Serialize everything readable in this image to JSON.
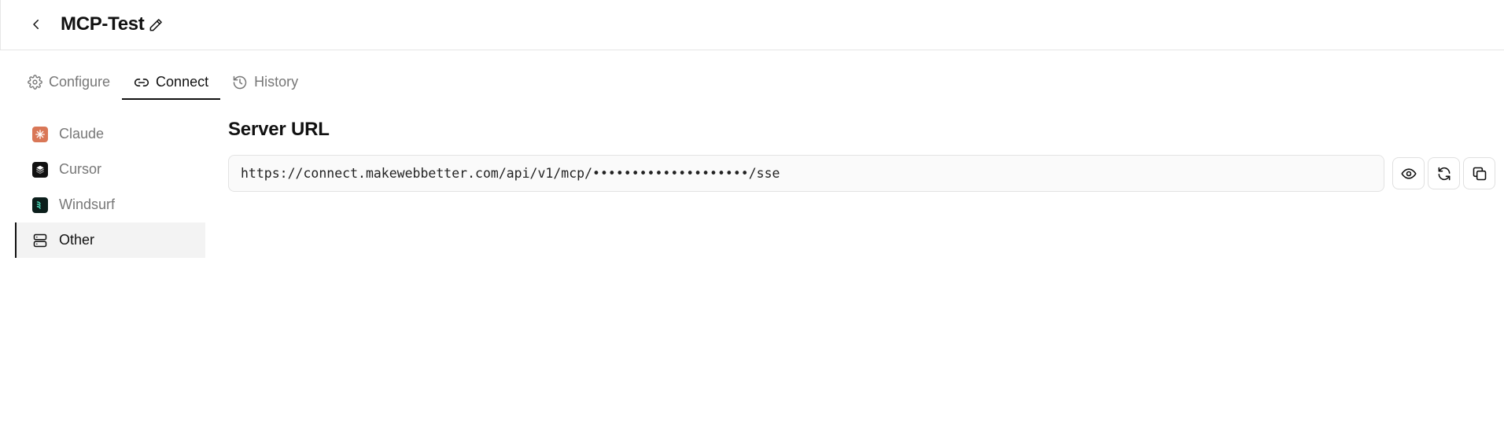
{
  "header": {
    "title": "MCP-Test",
    "back_icon": "chevron-left-icon",
    "edit_icon": "pencil-icon"
  },
  "tabs": [
    {
      "label": "Configure",
      "icon": "gear-icon",
      "active": false
    },
    {
      "label": "Connect",
      "icon": "link-icon",
      "active": true
    },
    {
      "label": "History",
      "icon": "history-icon",
      "active": false
    }
  ],
  "sidebar": {
    "items": [
      {
        "label": "Claude",
        "icon": "claude-logo-icon",
        "active": false
      },
      {
        "label": "Cursor",
        "icon": "cursor-logo-icon",
        "active": false
      },
      {
        "label": "Windsurf",
        "icon": "windsurf-logo-icon",
        "active": false
      },
      {
        "label": "Other",
        "icon": "server-icon",
        "active": true
      }
    ]
  },
  "main": {
    "section_title": "Server URL",
    "server_url": "https://connect.makewebbetter.com/api/v1/mcp/••••••••••••••••••••/sse",
    "actions": [
      {
        "name": "show-url-button",
        "icon": "eye-icon"
      },
      {
        "name": "regenerate-url-button",
        "icon": "refresh-icon"
      },
      {
        "name": "copy-url-button",
        "icon": "copy-icon"
      }
    ]
  },
  "colors": {
    "claude_brand": "#d97757",
    "active_background": "#f3f3f3",
    "border": "#e3e3e3",
    "field_background": "#fafafa"
  }
}
